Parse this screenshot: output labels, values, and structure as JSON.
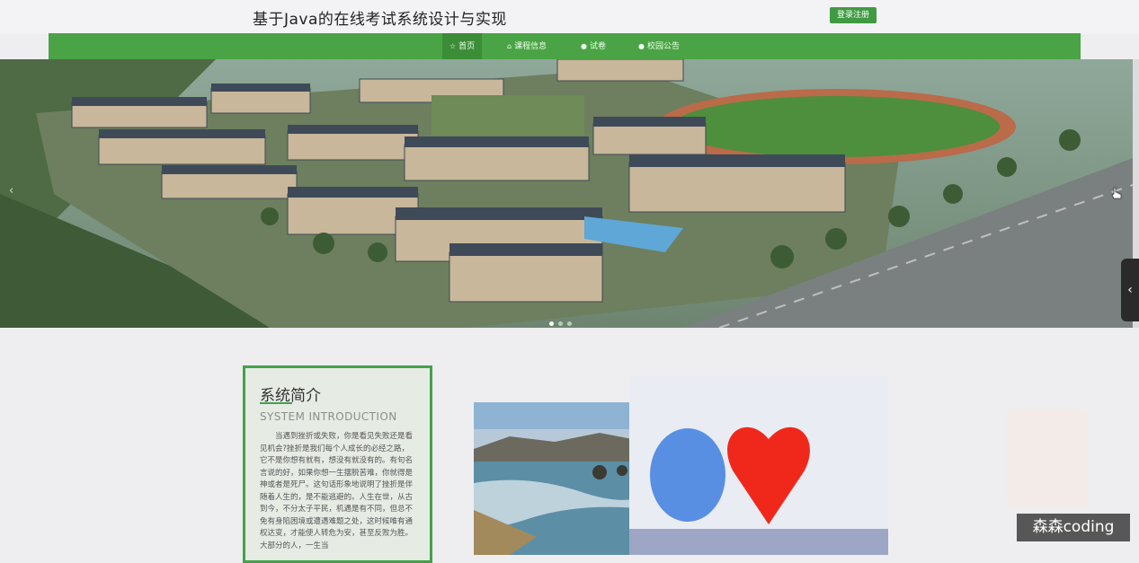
{
  "header": {
    "site_title": "基于Java的在线考试系统设计与实现",
    "login_label": "登录注册"
  },
  "nav": {
    "items": [
      {
        "label": "首页",
        "icon": "star-icon",
        "active": true
      },
      {
        "label": "课程信息",
        "icon": "home-icon",
        "active": false
      },
      {
        "label": "试卷",
        "icon": "circle-icon",
        "active": false
      },
      {
        "label": "校园公告",
        "icon": "circle-icon",
        "active": false
      }
    ]
  },
  "banner": {
    "slide_count": 3,
    "active_slide": 1,
    "prev_arrow": "‹",
    "side_tab_arrow": "‹"
  },
  "intro": {
    "title": "系统简介",
    "subtitle": "SYSTEM INTRODUCTION",
    "body": "当遇到挫折或失败，你是看见失败还是看见机会?挫折是我们每个人成长的必经之路，它不是你想有就有，想没有就没有的。有句名言说的好，如果你想一生摆脱苦难，你就得是神或者是死尸。这句话形象地说明了挫折是伴随着人生的，是不能逃避的。人生在世，从古到今，不分太子平民，机遇是有不同，但总不免有身陷困境或遭遇难题之处，这时候唯有通权达变，才能使人转危为安，甚至反败为胜。大部分的人，一生当"
  },
  "watermark": "森森coding",
  "colors": {
    "brand_green": "#4aa344",
    "nav_active": "#3c8d37",
    "border_green": "#46a04b"
  }
}
